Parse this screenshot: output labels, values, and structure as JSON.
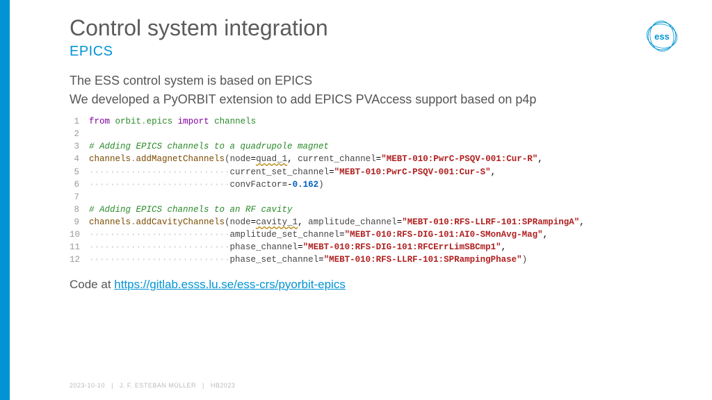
{
  "header": {
    "title": "Control system integration",
    "subtitle": "EPICS"
  },
  "bullets": {
    "line1": "The ESS control system is based on EPICS",
    "line2": "We developed a PyORBIT extension to add EPICS PVAccess support based on p4p"
  },
  "code": {
    "l1": {
      "from": "from",
      "sp1": " ",
      "mod1": "orbit",
      "dot": ".",
      "mod2": "epics",
      "sp2": " ",
      "import": "import",
      "sp3": " ",
      "mod3": "channels"
    },
    "l3_comment": "# Adding EPICS channels to a quadrupole magnet",
    "l4": {
      "obj": "channels",
      "dot": ".",
      "func": "addMagnetChannels",
      "open": "(",
      "p_node": "node",
      "eq": "=",
      "arg_node": "quad_1",
      "comma": ", ",
      "p_cc": "current_channel",
      "eq2": "=",
      "str_cc": "\"MEBT-010:PwrC-PSQV-001:Cur-R\"",
      "comma2": ","
    },
    "l5": {
      "indent": "···························",
      "p": "current_set_channel",
      "eq": "=",
      "str": "\"MEBT-010:PwrC-PSQV-001:Cur-S\"",
      "comma": ","
    },
    "l6": {
      "indent": "···························",
      "p": "convFactor",
      "eq": "=",
      "minus": "-",
      "num": "0.162",
      "close": ")"
    },
    "l8_comment": "# Adding EPICS channels to an RF cavity",
    "l9": {
      "obj": "channels",
      "dot": ".",
      "func": "addCavityChannels",
      "open": "(",
      "p_node": "node",
      "eq": "=",
      "arg_node": "cavity_1",
      "comma": ", ",
      "p_ac": "amplitude_channel",
      "eq2": "=",
      "str_ac": "\"MEBT-010:RFS-LLRF-101:SPRampingA\"",
      "comma2": ","
    },
    "l10": {
      "indent": "···························",
      "p": "amplitude_set_channel",
      "eq": "=",
      "str": "\"MEBT-010:RFS-DIG-101:AI0-SMonAvg-Mag\"",
      "comma": ","
    },
    "l11": {
      "indent": "···························",
      "p": "phase_channel",
      "eq": "=",
      "str": "\"MEBT-010:RFS-DIG-101:RFCErrLimSBCmp1\"",
      "comma": ","
    },
    "l12": {
      "indent": "···························",
      "p": "phase_set_channel",
      "eq": "=",
      "str": "\"MEBT-010:RFS-LLRF-101:SPRampingPhase\"",
      "close": ")"
    },
    "line_numbers": [
      "1",
      "2",
      "3",
      "4",
      "5",
      "6",
      "7",
      "8",
      "9",
      "10",
      "11",
      "12"
    ]
  },
  "code_at": {
    "prefix": "Code at ",
    "url": "https://gitlab.esss.lu.se/ess-crs/pyorbit-epics"
  },
  "footer": {
    "date": "2023-10-10",
    "author": "J. F. ESTEBAN MÜLLER",
    "conf": "HB2023"
  }
}
